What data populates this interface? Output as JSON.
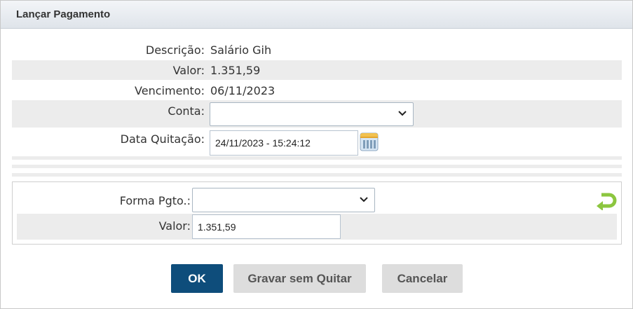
{
  "dialog": {
    "title": "Lançar Pagamento"
  },
  "fields": {
    "descricao": {
      "label": "Descrição:",
      "value": "Salário Gih"
    },
    "valor": {
      "label": "Valor:",
      "value": "1.351,59"
    },
    "vencimento": {
      "label": "Vencimento:",
      "value": "06/11/2023"
    },
    "conta": {
      "label": "Conta:",
      "selected": ""
    },
    "data_quitacao": {
      "label": "Data Quitação:",
      "value": "24/11/2023 - 15:24:12"
    }
  },
  "payment": {
    "forma_pgto": {
      "label": "Forma Pgto.:",
      "selected": ""
    },
    "valor": {
      "label": "Valor:",
      "value": "1.351,59"
    }
  },
  "buttons": {
    "ok": "OK",
    "save_without_settle": "Gravar sem Quitar",
    "cancel": "Cancelar"
  },
  "colors": {
    "primary_button": "#0e4d7b",
    "secondary_button": "#dddddd",
    "undo_icon": "#8cc63f",
    "row_shade": "#ececec"
  },
  "icons": {
    "calendar": "calendar-icon",
    "undo": "undo-arrow-icon",
    "dropdown": "chevron-down-icon"
  }
}
